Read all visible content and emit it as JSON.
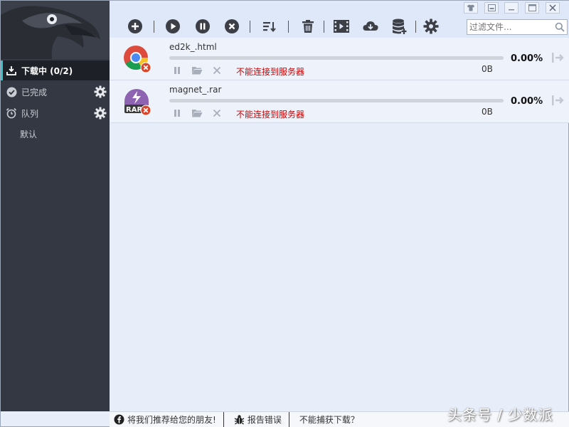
{
  "sidebar": {
    "items": [
      {
        "label": "下载中 (0/2)",
        "active": true
      },
      {
        "label": "已完成"
      },
      {
        "label": "队列"
      }
    ],
    "queue_sub": "默认"
  },
  "toolbar": {
    "search_placeholder": "过滤文件..."
  },
  "downloads": [
    {
      "name": "ed2k_.html",
      "percent": "0.00%",
      "size": "0B",
      "status": "不能连接到服务器",
      "icon": "chrome-icon",
      "progress": 0
    },
    {
      "name": "magnet_.rar",
      "percent": "0.00%",
      "size": "0B",
      "status": "不能连接到服务器",
      "icon": "rar-icon",
      "progress": 0
    }
  ],
  "statusbar": {
    "recommend": "将我们推荐给您的朋友!",
    "report": "报告错误",
    "cannot_capture": "不能捕获下载？"
  },
  "watermark": "头条号 / 少数派",
  "colors": {
    "accent": "#3ec1c9",
    "error": "#d00000",
    "sidebar": "#333842"
  }
}
